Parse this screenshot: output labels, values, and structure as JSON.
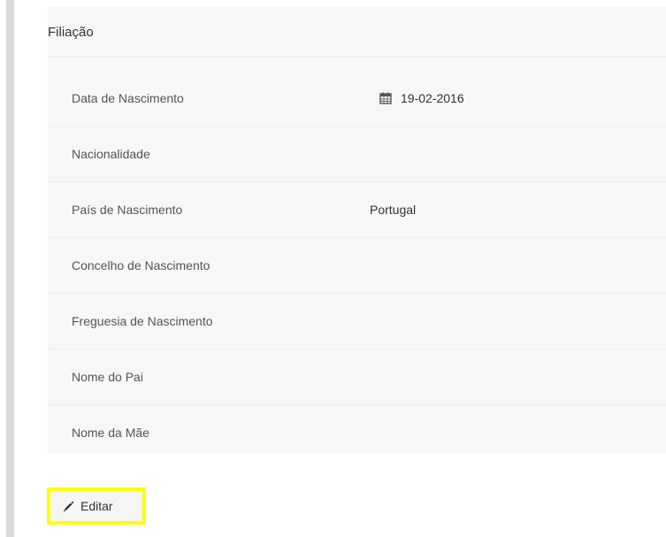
{
  "section": {
    "title": "Filiação"
  },
  "fields": [
    {
      "label": "Data de Nascimento",
      "value": "19-02-2016",
      "icon": "calendar-icon"
    },
    {
      "label": "Nacionalidade",
      "value": ""
    },
    {
      "label": "País de Nascimento",
      "value": "Portugal"
    },
    {
      "label": "Concelho de Nascimento",
      "value": ""
    },
    {
      "label": "Freguesia de Nascimento",
      "value": ""
    },
    {
      "label": "Nome do Pai",
      "value": ""
    },
    {
      "label": "Nome da Mãe",
      "value": ""
    }
  ],
  "actions": {
    "edit_label": "Editar",
    "edit_icon": "pencil-icon",
    "highlight_color": "#ffff00"
  }
}
